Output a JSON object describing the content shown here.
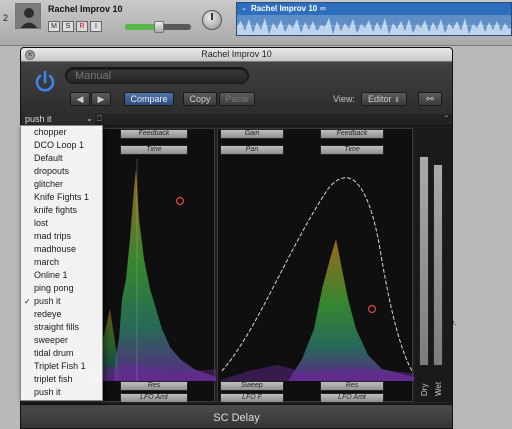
{
  "track": {
    "number": "2",
    "name": "Rachel Improv 10",
    "buttons": [
      "M",
      "S",
      "R",
      "I"
    ],
    "region_name": "Rachel Improv 10",
    "loop_icon": "loop-icon"
  },
  "plugin": {
    "window_title": "Rachel Improv 10",
    "preset": "Manual",
    "buttons": {
      "prev": "◀",
      "next": "▶",
      "compare": "Compare",
      "copy": "Copy",
      "paste": "Paste"
    },
    "view_label": "View:",
    "view_value": "Editor",
    "name": "SC Delay",
    "search_value": "push it",
    "left_labels_top": [
      "Feedback",
      "Time"
    ],
    "left_labels_bottom": [
      "Res",
      "LFO Amt"
    ],
    "mid_labels_top": [
      "Gain",
      "Pan"
    ],
    "mid_labels_bottom": [
      "Sweep",
      "LFO F"
    ],
    "right_labels_top": [
      "Feedback",
      "Time"
    ],
    "right_labels_bottom": [
      "Res",
      "LFO Amt"
    ],
    "side_labels": [
      "Dry",
      "Wet"
    ]
  },
  "presets": {
    "items": [
      "chopper",
      "DCO Loop 1",
      "Default",
      "dropouts",
      "glitcher",
      "Knife Fights 1",
      "knife fights",
      "lost",
      "mad trips",
      "madhouse",
      "march",
      "Online 1",
      "ping pong",
      "push it",
      "redeye",
      "straight fills",
      "sweeper",
      "tidal drum",
      "Triplet Fish 1",
      "triplet fish",
      "push it"
    ],
    "checked": "push it"
  },
  "background": {
    "partial_text": "e."
  },
  "colors": {
    "accent": "#2f6fd0",
    "power": "#3a86e8",
    "region": "#5e8ec6"
  }
}
